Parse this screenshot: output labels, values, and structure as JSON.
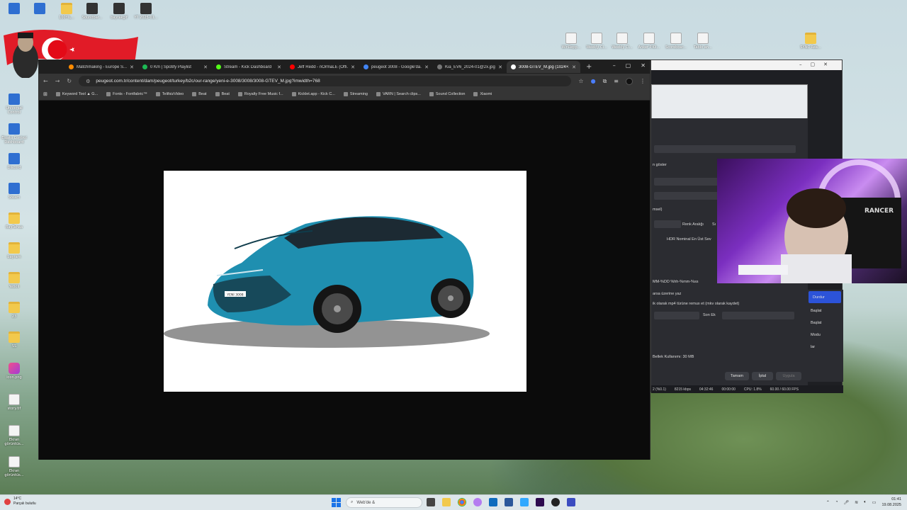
{
  "desktop": {
    "top_icons": [
      {
        "label": "",
        "type": "app"
      },
      {
        "label": "",
        "type": "app"
      },
      {
        "label": "100YIL...",
        "type": "folder"
      },
      {
        "label": "Soundbar...",
        "type": "dark"
      },
      {
        "label": "bayrakgif",
        "type": "dark"
      },
      {
        "label": "YT 2025-01...",
        "type": "dark"
      }
    ],
    "left_icons": [
      {
        "label": "Universal Control",
        "type": "app"
      },
      {
        "label": "Elgato Control Dashboard",
        "type": "app"
      },
      {
        "label": "Discord",
        "type": "app"
      },
      {
        "label": "Steam",
        "type": "app"
      },
      {
        "label": "BayTahaa",
        "type": "folder"
      },
      {
        "label": "bayram",
        "type": "folder"
      },
      {
        "label": "Yetkili",
        "type": "folder"
      },
      {
        "label": "23",
        "type": "folder"
      },
      {
        "label": "SS",
        "type": "folder"
      },
      {
        "label": "icon.png",
        "type": "pink"
      },
      {
        "label": "story.tif",
        "type": "doc"
      },
      {
        "label": "Ekran görüntüs...",
        "type": "doc"
      },
      {
        "label": "Ekran görüntüs...",
        "type": "doc"
      }
    ],
    "right_icons": [
      {
        "label": "WinRepp...",
        "type": "doc"
      },
      {
        "label": "Weekly Cl...",
        "type": "doc"
      },
      {
        "label": "Weekly Cl...",
        "type": "doc"
      },
      {
        "label": "Anker P.Kli...",
        "type": "doc"
      },
      {
        "label": "Scoreboar...",
        "type": "doc"
      },
      {
        "label": "Tablo an...",
        "type": "doc"
      },
      {
        "label": "SYNC Rea...",
        "type": "folder"
      }
    ]
  },
  "browser": {
    "tabs": [
      {
        "label": "Matchmaking - Europe S...",
        "favicon_color": "#ff8c00",
        "active": false
      },
      {
        "label": "0 Km | Spotify Playlist",
        "favicon_color": "#1db954",
        "active": false
      },
      {
        "label": "Stream - Kick Dashboard",
        "favicon_color": "#53fc18",
        "active": false
      },
      {
        "label": "Jeff Redd - nOrmaLE (Offi...",
        "favicon_color": "#ff0000",
        "active": false
      },
      {
        "label": "peugeot 3008 - Google'da...",
        "favicon_color": "#4285f4",
        "active": false
      },
      {
        "label": "Kia_EV6_2024-01@2x.jpg",
        "favicon_color": "#777777",
        "active": false
      },
      {
        "label": "3008-GTEV_M.jpg (1024×...",
        "favicon_color": "#ffffff",
        "active": true
      }
    ],
    "new_tab": "+",
    "window_controls": [
      "–",
      "▢",
      "✕"
    ],
    "url": "peugeot.com.tr/content/dam/peugeot/turkey/b2c/our-range/yeni-e-3008/3008/3008-GTEV_M.jpg?imwidth=768",
    "bookmarks": [
      "Keyword Tool ▲ G...",
      "Fonts - Fontfabric™",
      "TelifsizVideo",
      "Beat",
      "Beat",
      "Royalty Free Music f...",
      "Kicklet.app - Kick C...",
      "Streaming",
      "VARN | Search clips...",
      "Sound Collection",
      "Xiaomi"
    ],
    "image": {
      "plate_text": "YENİ 3008",
      "body_color": "#1f8fb0"
    }
  },
  "obs": {
    "settings_texts": {
      "show": "n göster",
      "feature_1": "msel)",
      "color_range": "Renk Aralığı",
      "color_range_short": "Sı",
      "hdr": "HDR Nominal En Üst Sev",
      "filename_format": "MM-%DD %hh-%mm-%ss",
      "overwrite": "arsa üzerine yaz",
      "remux": "ik olarak mp4 türüne remux et (mkv olarak kaydet)",
      "suffix": "Son Ek",
      "memory": "Bellek Kullanımı: 30 MB"
    },
    "buttons": {
      "ok": "Tamam",
      "cancel": "İptal",
      "apply": "Uygula"
    },
    "side_controls": [
      "Durdur",
      "Başlat",
      "Başlat",
      "Modu",
      "lar"
    ],
    "status": {
      "left": "2 (%0.1)",
      "bitrate": "8215 kbps",
      "time": "04:32:46",
      "rec": "00:00:00",
      "cpu": "CPU: 1.8%",
      "fps": "60.00 / 60.00 FPS"
    }
  },
  "taskbar": {
    "weather_temp": "14°C",
    "weather_desc": "Parçalı bulutlu",
    "search_placeholder": "Web'de &",
    "time": "01:41",
    "date": "19.08.2025"
  }
}
